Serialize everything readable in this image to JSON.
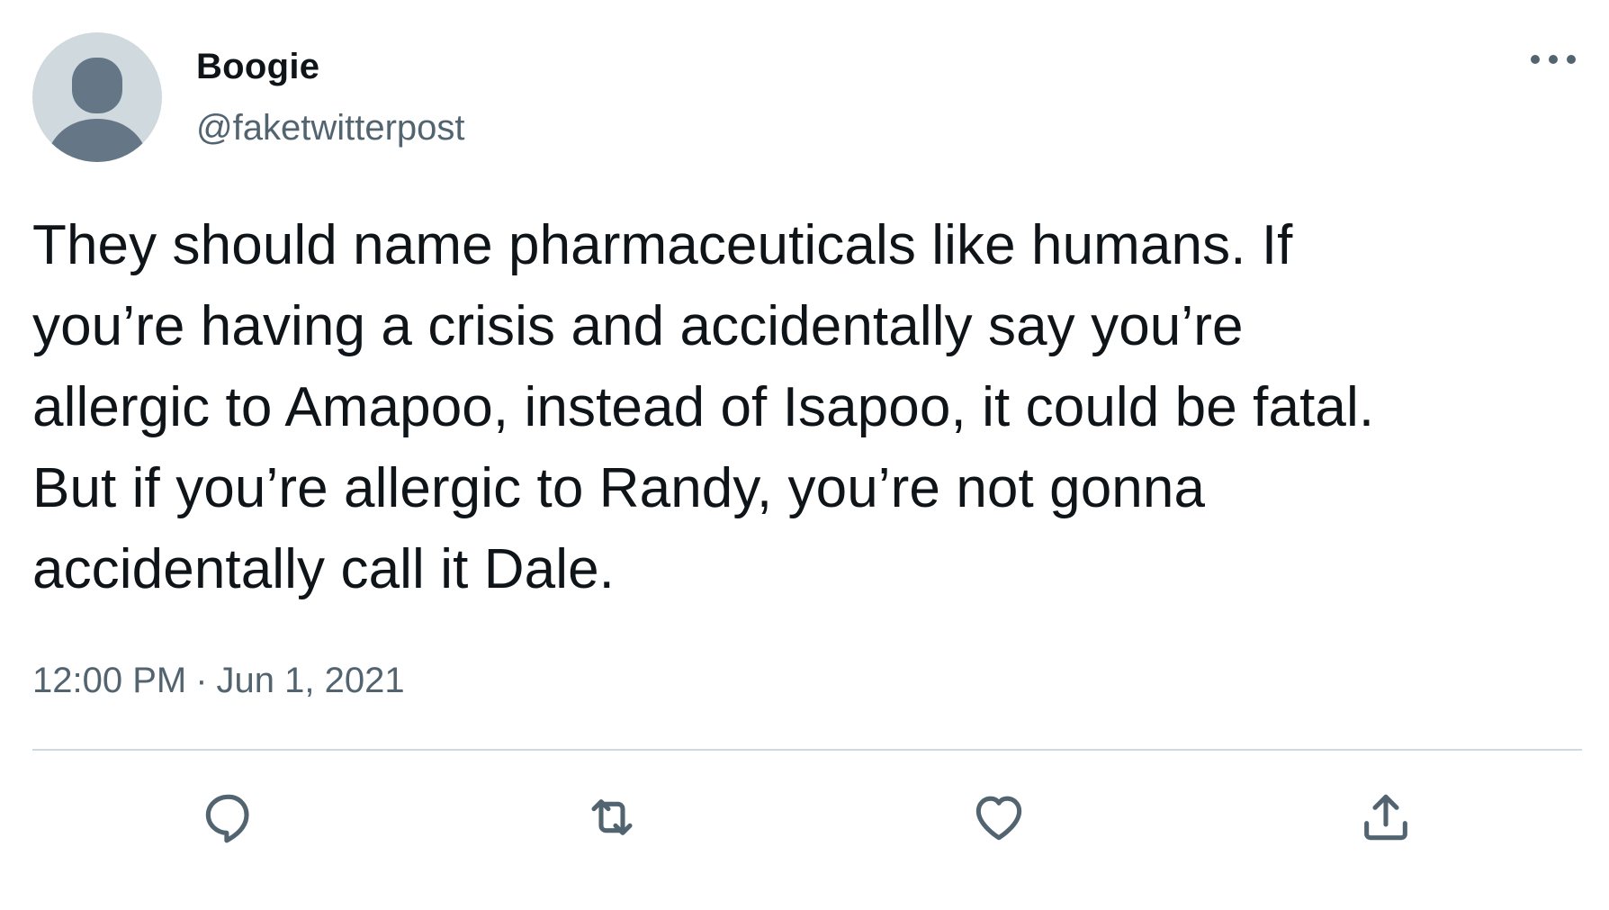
{
  "tweet": {
    "author": {
      "display_name": "Boogie",
      "handle": "@faketwitterpost",
      "avatar_icon": "default-avatar-icon"
    },
    "more_icon": "more-horizontal-icon",
    "text": "They should name pharmaceuticals like humans. If\nyou’re having a crisis and accidentally say you’re\nallergic to Amapoo, instead of Isapoo, it could be fatal.\nBut if you’re allergic to Randy, you’re not gonna\naccidentally call it Dale.",
    "time": "12:00 PM",
    "separator": "·",
    "date": "Jun 1, 2021",
    "actions": [
      {
        "name": "reply",
        "icon": "reply-icon"
      },
      {
        "name": "retweet",
        "icon": "retweet-icon"
      },
      {
        "name": "like",
        "icon": "heart-icon"
      },
      {
        "name": "share",
        "icon": "share-icon"
      }
    ]
  },
  "colors": {
    "text_primary": "#0f1419",
    "text_secondary": "#536471",
    "avatar_bg": "#cfd9de",
    "avatar_figure": "#657786",
    "divider": "#cfd9de"
  }
}
